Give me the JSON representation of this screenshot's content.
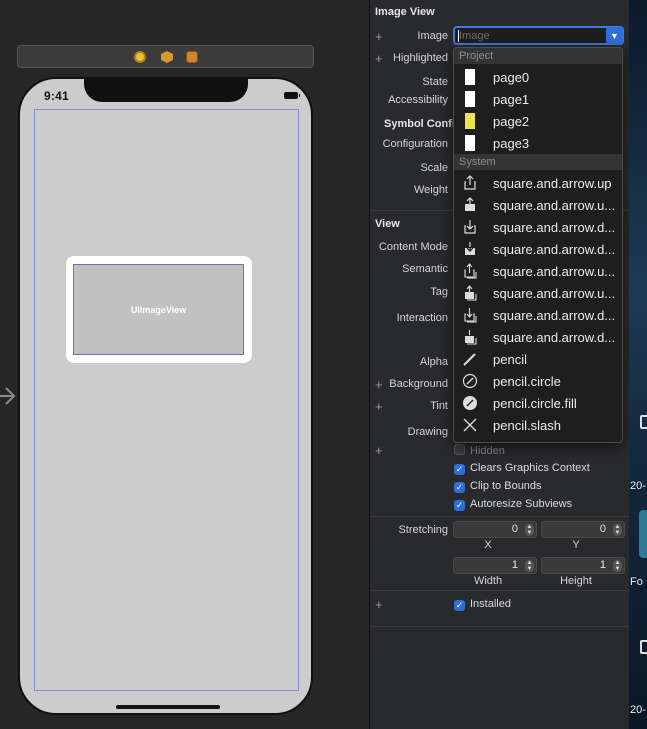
{
  "canvas": {
    "status_time": "9:41",
    "image_view_label": "UIImageView"
  },
  "inspector": {
    "image_view_section": "Image View",
    "image_label": "Image",
    "image_placeholder": "Image",
    "highlighted_label": "Highlighted",
    "state_label": "State",
    "accessibility_label": "Accessibility",
    "symbol_config_label": "Symbol Config",
    "configuration_label": "Configuration",
    "scale_label": "Scale",
    "weight_label": "Weight",
    "view_section": "View",
    "content_mode_label": "Content Mode",
    "semantic_label": "Semantic",
    "tag_label": "Tag",
    "interaction_label": "Interaction",
    "alpha_label": "Alpha",
    "background_label": "Background",
    "tint_label": "Tint",
    "drawing_label": "Drawing",
    "hidden_label": "Hidden",
    "clears_graphics_label": "Clears Graphics Context",
    "clip_to_bounds_label": "Clip to Bounds",
    "autoresize_label": "Autoresize Subviews",
    "stretching_label": "Stretching",
    "stretch_x_value": "0",
    "stretch_y_value": "0",
    "stretch_w_value": "1",
    "stretch_h_value": "1",
    "x_caption": "X",
    "y_caption": "Y",
    "width_caption": "Width",
    "height_caption": "Height",
    "installed_label": "Installed",
    "plus_symbol": "+"
  },
  "dropdown": {
    "project_header": "Project",
    "system_header": "System",
    "project_items": [
      {
        "label": "page0",
        "thumb": "white"
      },
      {
        "label": "page1",
        "thumb": "white"
      },
      {
        "label": "page2",
        "thumb": "yellow"
      },
      {
        "label": "page3",
        "thumb": "white"
      }
    ],
    "system_items": [
      {
        "label": "square.and.arrow.up",
        "icon": "share-up-icon"
      },
      {
        "label": "square.and.arrow.u...",
        "icon": "share-up-fill-icon"
      },
      {
        "label": "square.and.arrow.d...",
        "icon": "share-down-icon"
      },
      {
        "label": "square.and.arrow.d...",
        "icon": "share-down-fill-icon"
      },
      {
        "label": "square.and.arrow.u...",
        "icon": "share-up-stack-icon"
      },
      {
        "label": "square.and.arrow.u...",
        "icon": "share-up-stack-fill-icon"
      },
      {
        "label": "square.and.arrow.d...",
        "icon": "share-down-stack-icon"
      },
      {
        "label": "square.and.arrow.d...",
        "icon": "share-down-stack-fill-icon"
      },
      {
        "label": "pencil",
        "icon": "pencil-icon"
      },
      {
        "label": "pencil.circle",
        "icon": "pencil-circle-icon"
      },
      {
        "label": "pencil.circle.fill",
        "icon": "pencil-circle-fill-icon"
      },
      {
        "label": "pencil.slash",
        "icon": "pencil-slash-icon"
      }
    ]
  },
  "desktop": {
    "text_1": "20-",
    "text_2": "Fo",
    "text_3": "20-"
  },
  "colors": {
    "accent": "#2f6ed8",
    "inspector_bg": "#292a2d",
    "canvas_bg": "#262626"
  }
}
